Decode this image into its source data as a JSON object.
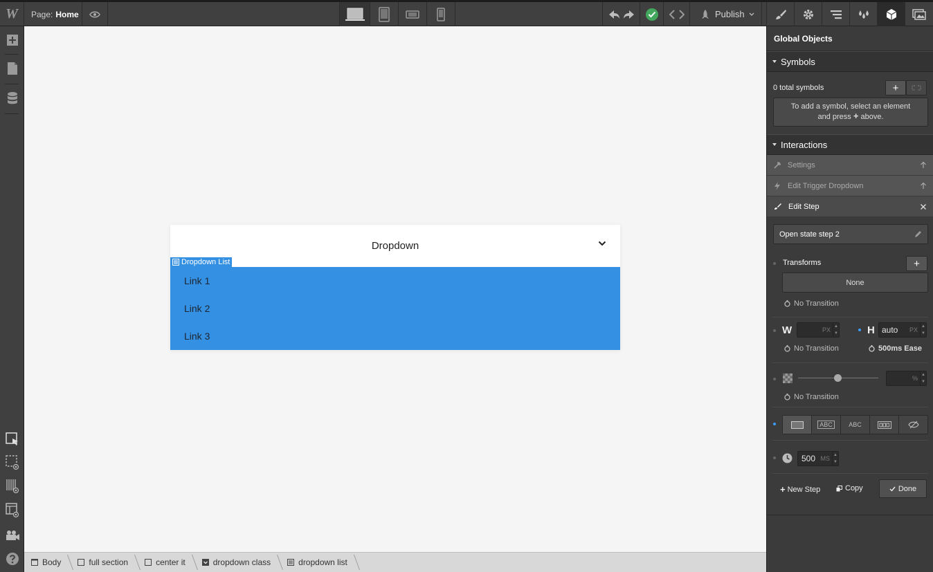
{
  "topbar": {
    "logo": "W",
    "page_prefix": "Page:",
    "page_name": "Home",
    "publish_label": "Publish"
  },
  "canvas": {
    "dropdown_label": "Dropdown",
    "selected_tag": "Dropdown List",
    "links": [
      "Link 1",
      "Link 2",
      "Link 3"
    ],
    "accent": "#3490e3"
  },
  "breadcrumb": [
    "Body",
    "full section",
    "center it",
    "dropdown class",
    "dropdown list"
  ],
  "panel": {
    "title": "Global Objects",
    "symbols": {
      "header": "Symbols",
      "count": "0 total symbols",
      "hint_line1": "To add a symbol, select an element",
      "hint_line2a": "and press",
      "hint_line2b": "above."
    },
    "interactions": {
      "header": "Interactions",
      "settings": "Settings",
      "edit_trigger": "Edit Trigger Dropdown",
      "edit_step": "Edit Step",
      "step_name": "Open state step 2",
      "transforms": "Transforms",
      "transforms_value": "None",
      "no_transition": "No Transition",
      "w_label": "W",
      "h_label": "H",
      "unit_px": "PX",
      "h_value": "auto",
      "h_transition": "500ms Ease",
      "unit_pct": "%",
      "display_options": [
        "ABC",
        "ABC"
      ],
      "duration": "500",
      "unit_ms": "MS",
      "new_step": "New Step",
      "copy": "Copy",
      "done": "Done"
    }
  }
}
